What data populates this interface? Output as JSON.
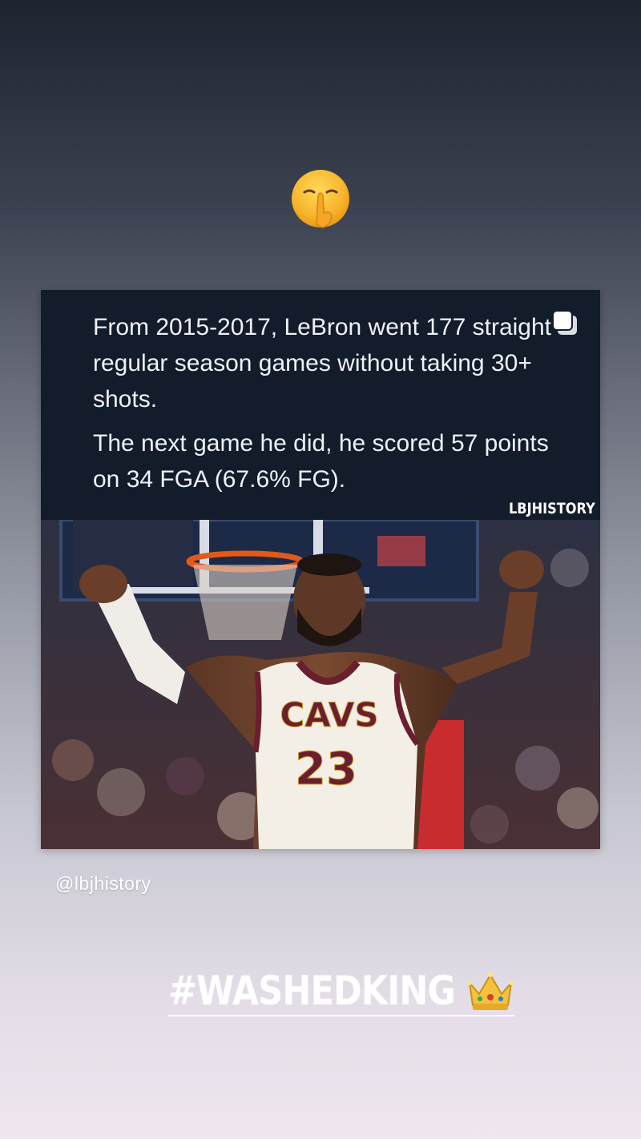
{
  "story": {
    "sticker_emoji": "shushing-face",
    "post": {
      "paragraphs": [
        "From 2015-2017, LeBron went 177 straight regular season games without taking 30+ shots.",
        "The next game he did, he scored 57 points on 34 FGA (67.6% FG)."
      ],
      "brand_watermark": "LBJHISTORY",
      "multi_icon": "carousel-icon",
      "jersey_text": "CAVS",
      "jersey_number": "23"
    },
    "mention": "@lbjhistory",
    "hashtag": "#WASHEDKING",
    "hashtag_emoji": "crown-icon"
  },
  "colors": {
    "card_bg": "#121c2b",
    "jersey": "#f4efe6",
    "wine": "#6b1f2e",
    "gold": "#c99a2e"
  }
}
